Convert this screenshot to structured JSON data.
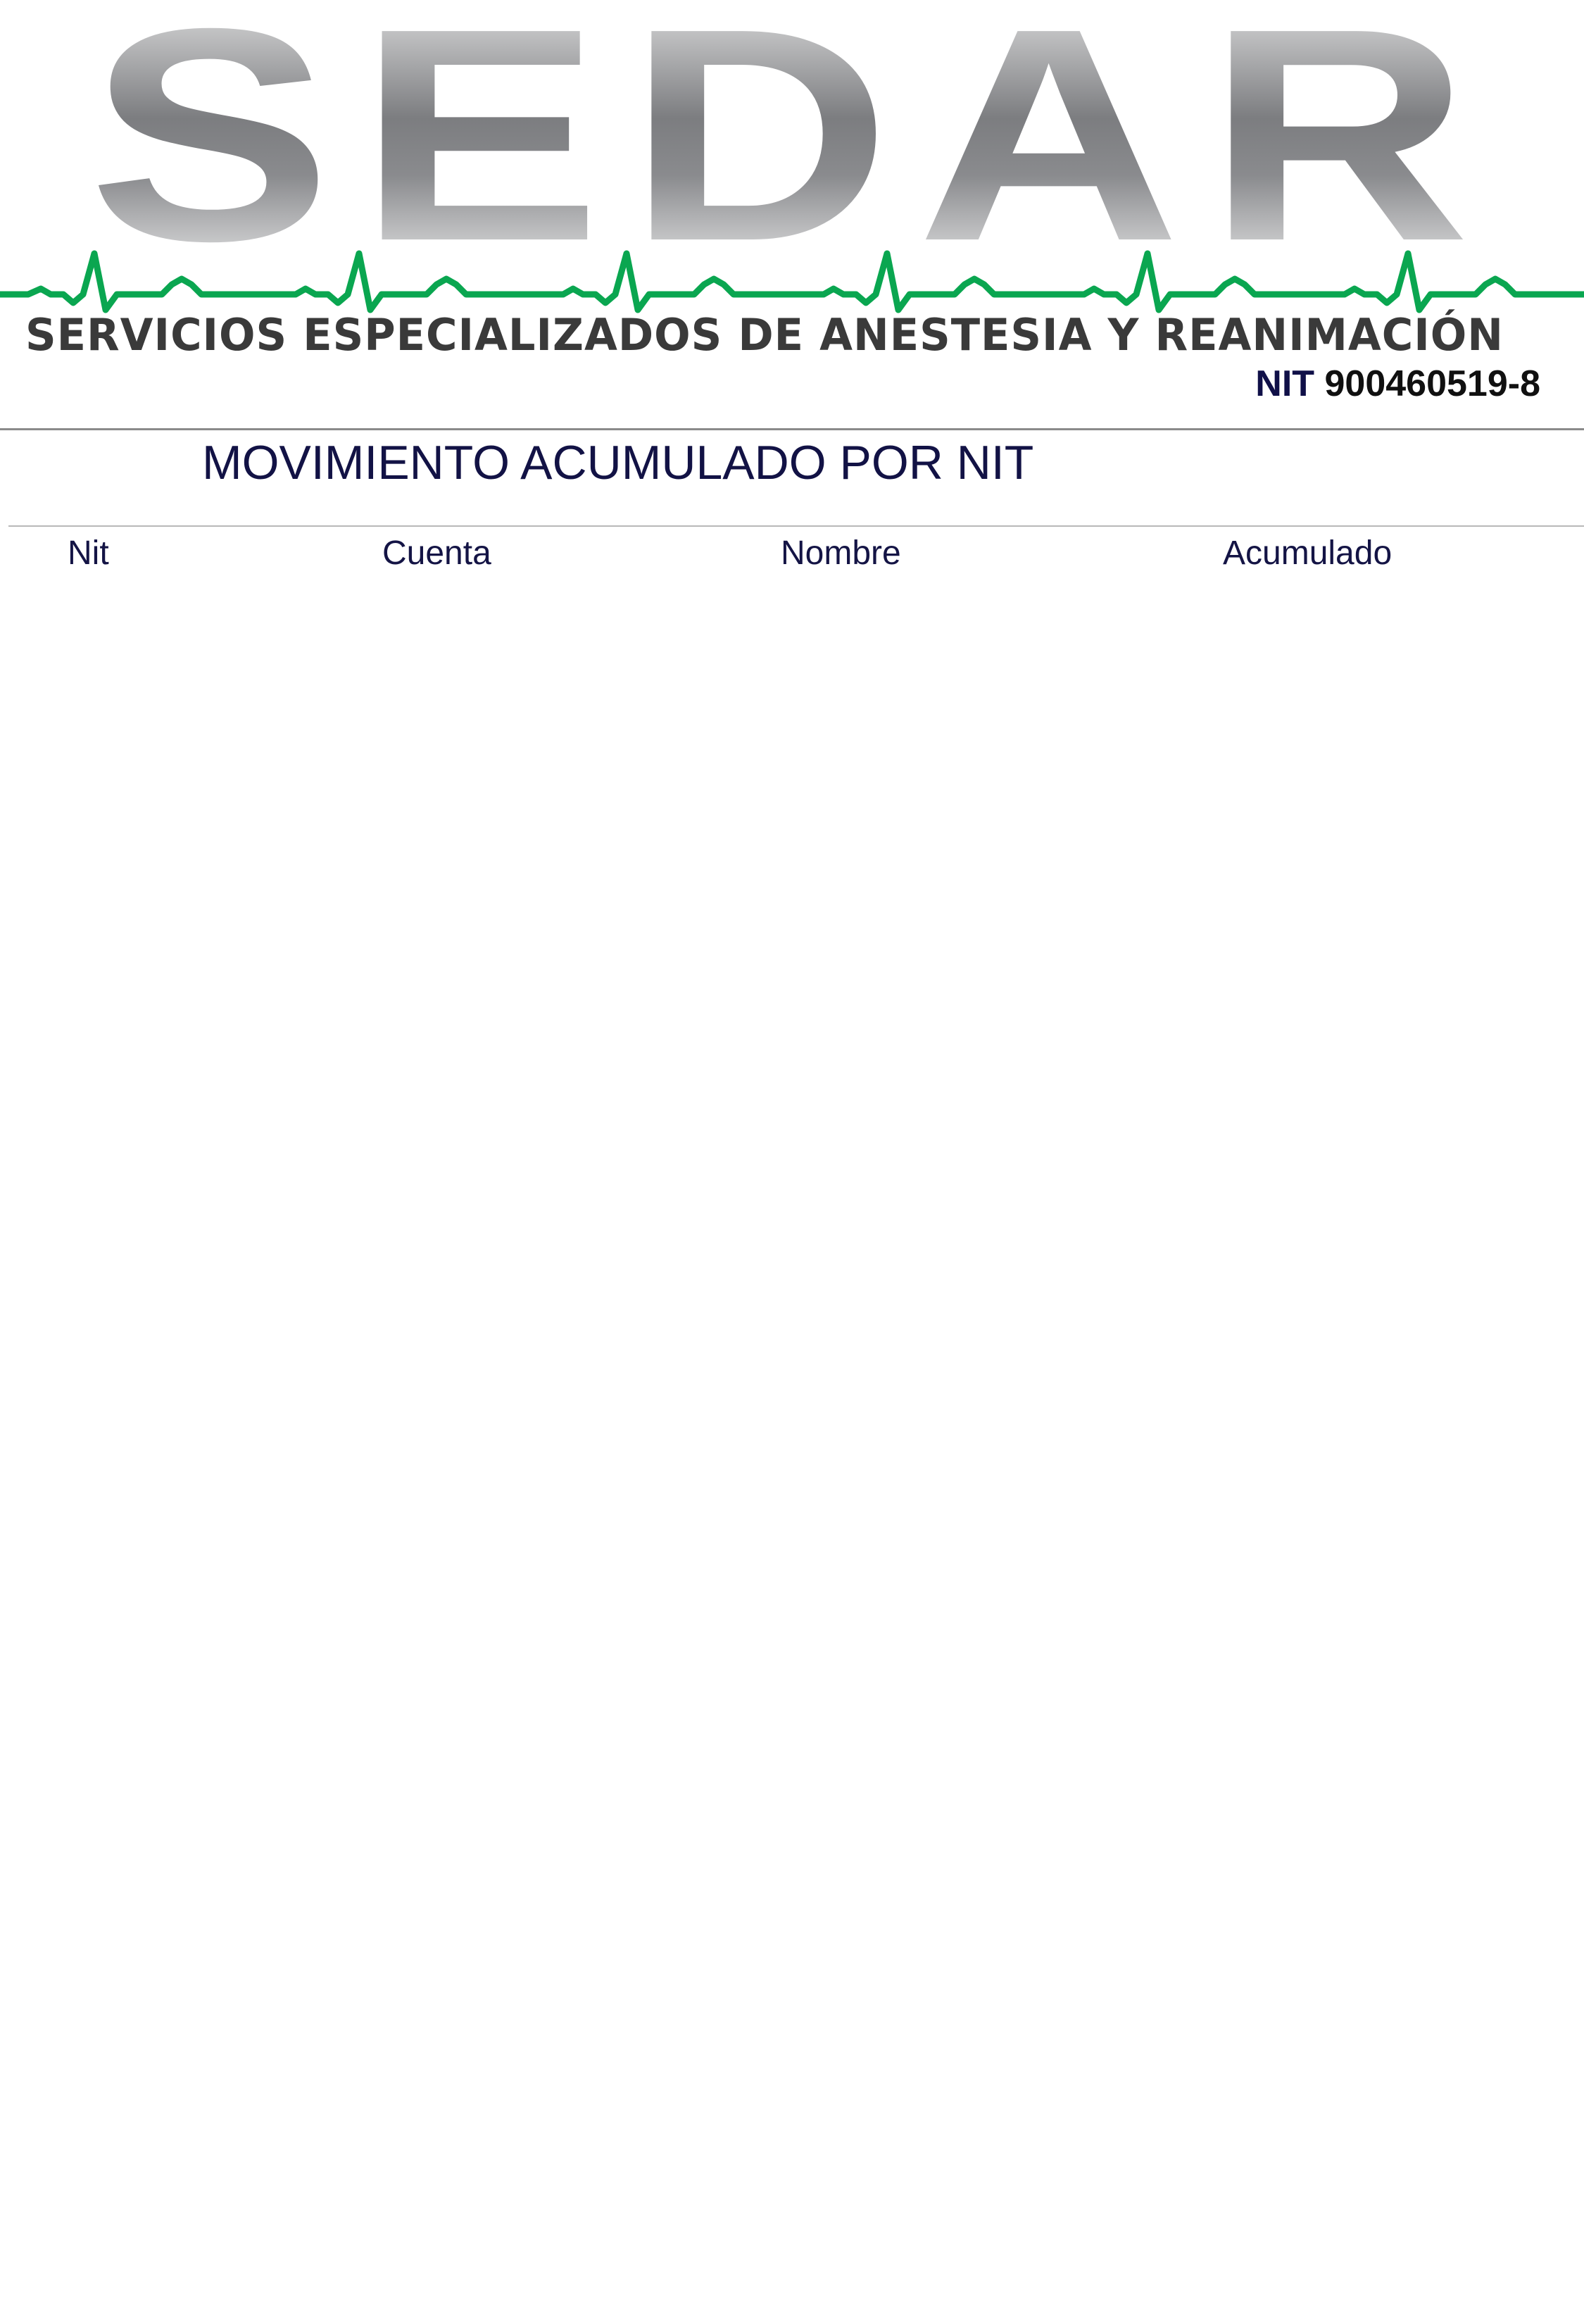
{
  "header": {
    "logo_text": "SEDAR",
    "tagline": "SERVICIOS ESPECIALIZADOS DE ANESTESIA Y REANIMACIÓN",
    "nit_label": "NIT",
    "nit_number": "900460519-8",
    "logo_icon": "ecg-heartbeat-line",
    "colors": {
      "logo_gray_dark": "#7c7d80",
      "logo_gray_light": "#f2f2f2",
      "ecg_green": "#0aa650",
      "tagline_gray": "#3a3a3a"
    }
  },
  "report": {
    "title": "MOVIMIENTO ACUMULADO POR NIT"
  },
  "table": {
    "columns": [
      "Nit",
      "Cuenta",
      "Nombre",
      "Acumulado"
    ],
    "rows": []
  }
}
